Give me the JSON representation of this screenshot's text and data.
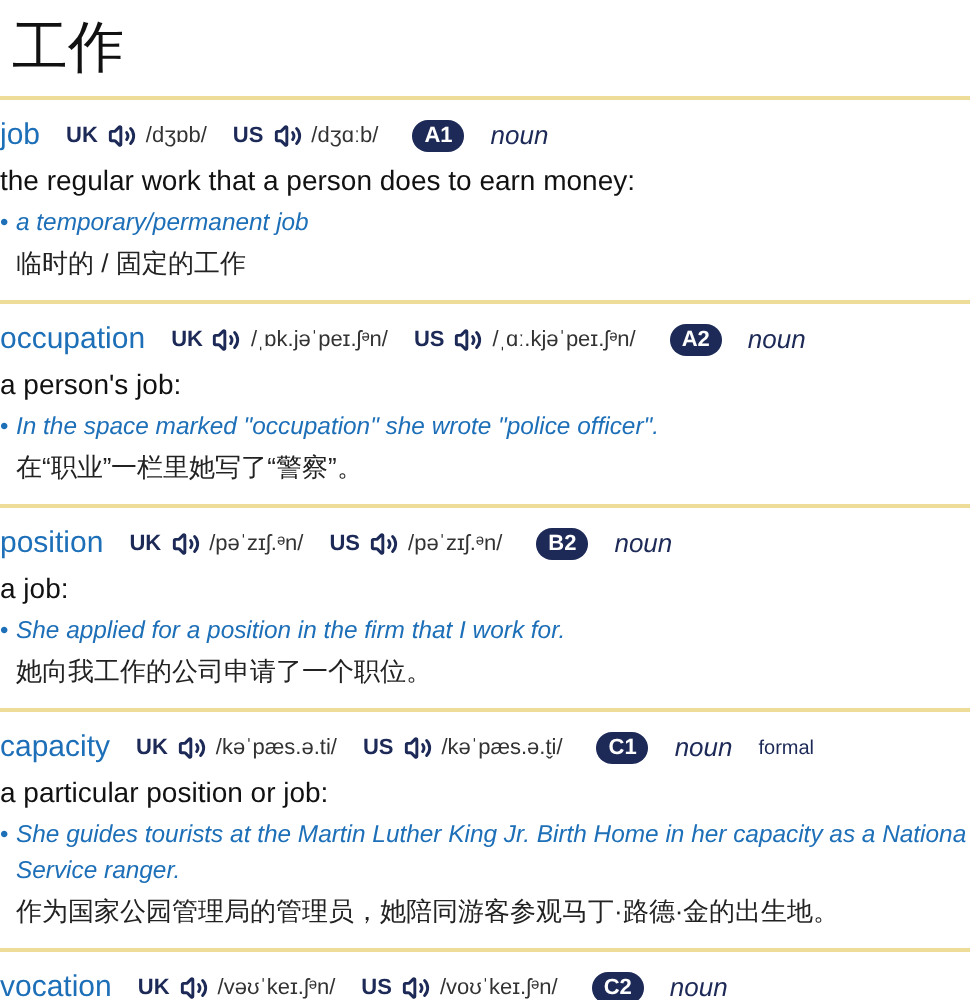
{
  "title": "工作",
  "entries": [
    {
      "headword": "job",
      "uk_label": "UK",
      "uk_ipa": "/dʒɒb/",
      "us_label": "US",
      "us_ipa": "/dʒɑːb/",
      "level": "A1",
      "pos": "noun",
      "definition": "the regular work that a person does to earn money:",
      "bullet": "•",
      "example_lines": [
        "a temporary/permanent job"
      ],
      "translation": "临时的 / 固定的工作"
    },
    {
      "headword": "occupation",
      "uk_label": "UK",
      "uk_ipa": "/ˌɒk.jəˈpeɪ.ʃᵊn/",
      "us_label": "US",
      "us_ipa": "/ˌɑː.kjəˈpeɪ.ʃᵊn/",
      "level": "A2",
      "pos": "noun",
      "definition": "a person's job:",
      "bullet": "•",
      "example_lines": [
        "In the space marked \"occupation\" she wrote \"police officer\"."
      ],
      "translation": "在“职业”一栏里她写了“警察”。"
    },
    {
      "headword": "position",
      "uk_label": "UK",
      "uk_ipa": "/pəˈzɪʃ.ᵊn/",
      "us_label": "US",
      "us_ipa": "/pəˈzɪʃ.ᵊn/",
      "level": "B2",
      "pos": "noun",
      "definition": "a job:",
      "bullet": "•",
      "example_lines": [
        "She applied for a position in the firm that I work for."
      ],
      "translation": "她向我工作的公司申请了一个职位。"
    },
    {
      "headword": "capacity",
      "uk_label": "UK",
      "uk_ipa": "/kəˈpæs.ə.ti/",
      "us_label": "US",
      "us_ipa": "/kəˈpæs.ə.t̬i/",
      "level": "C1",
      "pos": "noun",
      "register": "formal",
      "definition": "a particular position or job:",
      "bullet": "•",
      "example_lines": [
        "She guides tourists at the Martin Luther King Jr. Birth Home in her capacity as a Nationa",
        "Service ranger."
      ],
      "translation": "作为国家公园管理局的管理员，她陪同游客参观马丁·路德·金的出生地。"
    },
    {
      "headword": "vocation",
      "uk_label": "UK",
      "uk_ipa": "/vəʊˈkeɪ.ʃᵊn/",
      "us_label": "US",
      "us_ipa": "/voʊˈkeɪ.ʃᵊn/",
      "level": "C2",
      "pos": "noun"
    }
  ]
}
